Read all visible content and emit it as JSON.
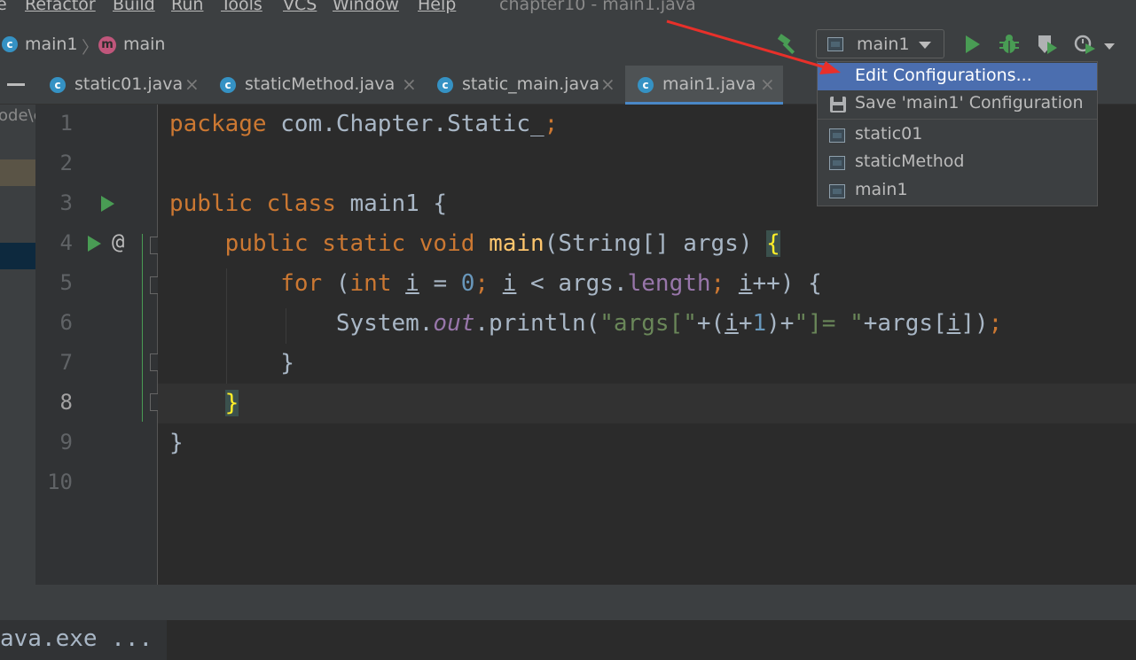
{
  "menu": {
    "items": [
      "e",
      "Refactor",
      "Build",
      "Run",
      "Tools",
      "VCS",
      "Window",
      "Help"
    ],
    "window_title": "chapter10 - main1.java"
  },
  "breadcrumb": {
    "class_name": "main1",
    "method_name": "main",
    "class_icon_letter": "c",
    "method_icon_letter": "m"
  },
  "run_config": {
    "selected": "main1"
  },
  "tabs": [
    {
      "label": "static01.java",
      "active": false
    },
    {
      "label": "staticMethod.java",
      "active": false
    },
    {
      "label": "static_main.java",
      "active": false
    },
    {
      "label": "main1.java",
      "active": true
    }
  ],
  "tab_close_glyph": "×",
  "left_panel_text": "ode\\c",
  "editor": {
    "line_numbers": [
      "1",
      "2",
      "3",
      "4",
      "5",
      "6",
      "7",
      "8",
      "9",
      "10"
    ],
    "current_line": "8",
    "gutter_at_marker": "@",
    "code": {
      "l1_kw": "package",
      "l1_rest": " com.Chapter.Static_",
      "l1_semi": ";",
      "l3_kw1": "public",
      "l3_kw2": "class",
      "l3_rest": " main1 {",
      "l4_kw1": "public",
      "l4_kw2": "static",
      "l4_kw3": "void",
      "l4_fn": "main",
      "l4_params": "(String[] args) ",
      "l4_brace": "{",
      "l5_kw": "for",
      "l5_open": " (",
      "l5_int": "int",
      "l5_i1": "i",
      "l5_eq": " = ",
      "l5_zero": "0",
      "l5_semi1": ";",
      "l5_i2": "i",
      "l5_lt": " < args.",
      "l5_length": "length",
      "l5_semi2": ";",
      "l5_i3": "i",
      "l5_tail": "++) {",
      "l6_sys": "System.",
      "l6_out": "out",
      "l6_print": ".println(",
      "l6_str1": "\"args[\"",
      "l6_plus1": "+(",
      "l6_i1": "i",
      "l6_plus2": "+",
      "l6_one": "1",
      "l6_close": ")+",
      "l6_str2": "\"]= \"",
      "l6_plus3": "+args[",
      "l6_i2": "i",
      "l6_end": "])",
      "l6_semi": ";",
      "l7": "}",
      "l8_brace": "}",
      "l9": "}"
    }
  },
  "popup": {
    "items": [
      {
        "label": "Edit Configurations...",
        "selected": true
      },
      {
        "label": "Save 'main1' Configuration",
        "selected": false
      },
      {
        "label": "static01",
        "selected": false
      },
      {
        "label": "staticMethod",
        "selected": false
      },
      {
        "label": "main1",
        "selected": false
      }
    ]
  },
  "console": {
    "text": "ava.exe ..."
  },
  "colors": {
    "accent_selection": "#4b6eaf",
    "run_green": "#499c54",
    "annotation_red": "#e8302a"
  },
  "toolbar_icons": [
    "hammer-icon",
    "run-icon",
    "debug-icon",
    "coverage-icon",
    "profiler-icon"
  ]
}
